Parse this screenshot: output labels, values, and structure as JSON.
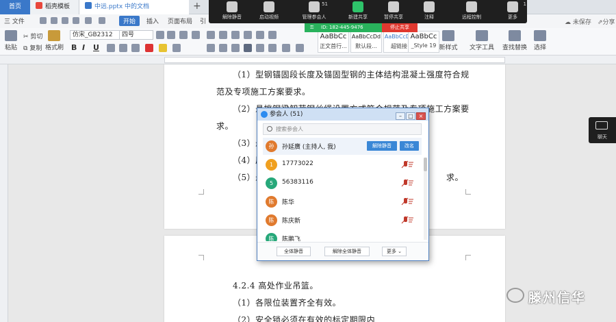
{
  "tabs": {
    "home": "首页",
    "template": "稻壳模板",
    "doc": "中远.pptx 中的文档",
    "add": "+"
  },
  "menu": {
    "file": "三 文件",
    "start": "开始",
    "insert": "插入",
    "layout": "页面布局",
    "ref": "引"
  },
  "status": {
    "unsaved": "未保存",
    "share": "分享"
  },
  "ribbon": {
    "paste": "粘贴",
    "cut": "剪切",
    "copy": "复制",
    "format_painter": "格式刷",
    "font_name": "仿宋_GB2312",
    "font_size": "四号",
    "bold": "B",
    "italic": "I",
    "underline": "U",
    "styles": [
      {
        "sample": "AaBbCc",
        "name": "正文首行..."
      },
      {
        "sample": "AaBbCcDd",
        "name": "默认段..."
      },
      {
        "sample": "AaBbCcDd",
        "name": "超链接"
      },
      {
        "sample": "AaBbCc",
        "name": "_Style 19"
      }
    ],
    "new_style": "新样式",
    "text_tools": "文字工具",
    "find_replace": "查找替换",
    "select": "选择"
  },
  "meeting": {
    "mute": "解除静音",
    "video": "启动视频",
    "participants": "管理参会人",
    "participant_count": "51",
    "new_share": "新建共享",
    "pause_share": "暂停共享",
    "annotate": "注释",
    "remote": "远程控制",
    "more": "更多",
    "more_count": "1",
    "meeting_id": "ID: 182-445-9476",
    "stop_share": "停止共享"
  },
  "document": {
    "lines": [
      "（1）型钢锚固段长度及锚固型钢的主体结构混凝土强度符合规",
      "范及专项施工方案要求。",
      "（2）悬挑钢梁卸荷钢丝绳设置方式符合规范及专项施工方案要",
      "求。",
      "（3）悬",
      "（4）层",
      "（5）悬",
      "求。"
    ],
    "page2_lines": [
      "4.2.4  高处作业吊篮。",
      "（1）各限位装置齐全有效。",
      "（2）安全锁必须在有效的标定期限内"
    ]
  },
  "participants_window": {
    "title": "参会人 (51)",
    "search_placeholder": "搜索参会人",
    "host": {
      "avatar": "孙",
      "name": "孙延廣 (主持人, 我)",
      "unmute_btn": "解除静音",
      "rename_btn": "改名"
    },
    "people": [
      {
        "avatar": "1",
        "name": "17773022",
        "color": "#f0a020"
      },
      {
        "avatar": "5",
        "name": "56383116",
        "color": "#27a87a"
      },
      {
        "avatar": "陈",
        "name": "陈华",
        "color": "#e07a2e"
      },
      {
        "avatar": "陈",
        "name": "陈庆新",
        "color": "#e07a2e"
      },
      {
        "avatar": "陈",
        "name": "陈鹏飞",
        "color": "#27a87a"
      }
    ],
    "mute_all": "全体静音",
    "unmute_all": "解除全体静音",
    "more": "更多 ⌄"
  },
  "chat": {
    "label": "聊天"
  },
  "watermark": {
    "text": "滕州信华"
  },
  "colors": {
    "accent": "#3a78c9",
    "meeting_bg": "#1f1f1f",
    "share_green": "#29b25c",
    "stop_red": "#e0382f",
    "action_blue": "#3a87d6"
  }
}
